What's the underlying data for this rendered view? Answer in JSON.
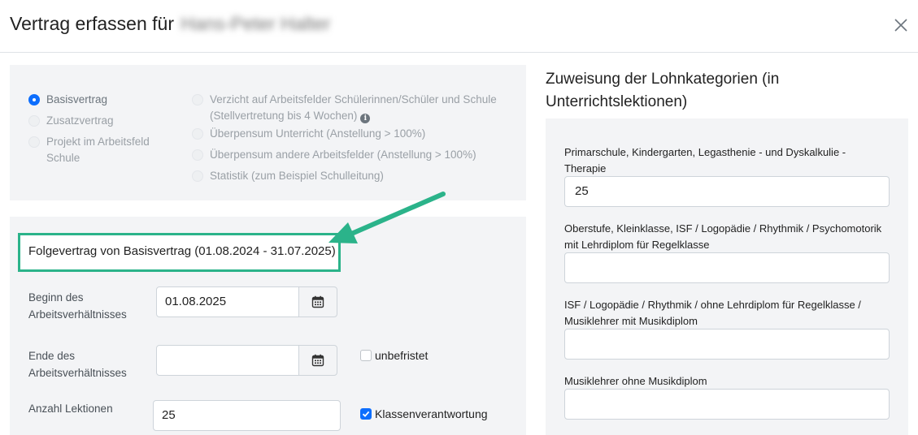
{
  "modal": {
    "title": "Vertrag erfassen für",
    "person_name": "Hans-Peter Halter",
    "close_icon": "close-icon"
  },
  "contract_types": {
    "left": [
      {
        "label": "Basisvertrag",
        "checked": true
      },
      {
        "label": "Zusatzvertrag",
        "checked": false
      },
      {
        "label": "Projekt im Arbeitsfeld Schule",
        "checked": false
      }
    ],
    "right": [
      {
        "label": "Verzicht auf Arbeitsfelder Schülerinnen/Schüler und Schule (Stellvertretung bis 4 Wochen)",
        "checked": false,
        "icon": "info-icon"
      },
      {
        "label": "Überpensum Unterricht (Anstellung > 100%)",
        "checked": false
      },
      {
        "label": "Überpensum andere Arbeitsfelder (Anstellung > 100%)",
        "checked": false
      },
      {
        "label": "Statistik (zum Beispiel Schulleitung)",
        "checked": false
      }
    ]
  },
  "follow_contract": {
    "text": "Folgevertrag von Basisvertrag (01.08.2024 - 31.07.2025)",
    "highlight_color": "#2bb38a"
  },
  "form": {
    "begin_label": "Beginn des Arbeitsverhältnisses",
    "begin_value": "01.08.2025",
    "end_label": "Ende des Arbeitsverhältnisses",
    "end_value": "",
    "unbefristet_label": "unbefristet",
    "unbefristet_checked": false,
    "lessons_label": "Anzahl Lektionen",
    "lessons_value": "25",
    "class_responsibility_label": "Klassenverantwortung",
    "class_responsibility_checked": true,
    "calendar_icon": "calendar-icon"
  },
  "wage_categories": {
    "title": "Zuweisung der Lohnkategorien (in Unterrichtslektionen)",
    "items": [
      {
        "label": "Primarschule, Kindergarten, Legasthenie - und Dyskalkulie - Therapie",
        "value": "25"
      },
      {
        "label": "Oberstufe, Kleinklasse, ISF / Logopädie / Rhythmik / Psychomotorik mit Lehrdiplom für Regelklasse",
        "value": ""
      },
      {
        "label": "ISF / Logopädie / Rhythmik / ohne Lehrdiplom für Regelklasse / Musiklehrer mit Musikdiplom",
        "value": ""
      },
      {
        "label": "Musiklehrer ohne Musikdiplom",
        "value": ""
      }
    ]
  },
  "colors": {
    "accent": "#0d6efd",
    "panel_bg": "#f3f4f6",
    "annotation": "#2bb38a"
  }
}
